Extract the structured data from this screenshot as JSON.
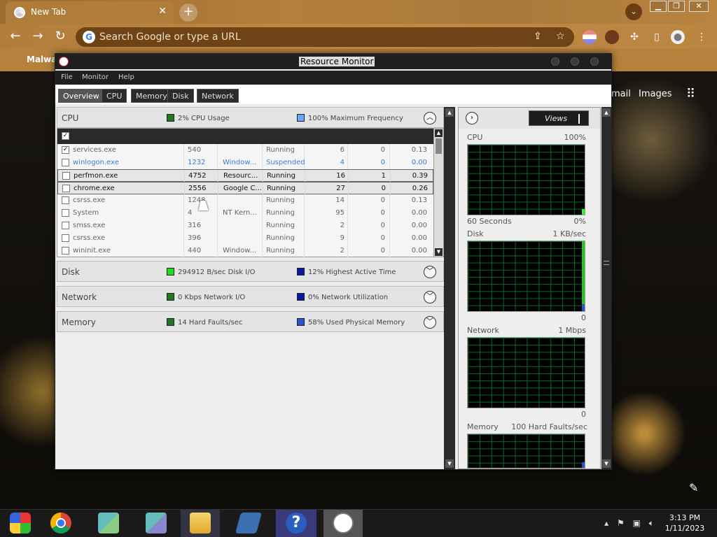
{
  "browser": {
    "tab_title": "New Tab",
    "tab_close": "✕",
    "new_tab": "+",
    "omnibox_placeholder": "Search Google or type a URL",
    "bookmark": "Malwar",
    "ntp_gmail": "mail",
    "ntp_images": "Images"
  },
  "rm": {
    "title": "Resource Monitor",
    "menu": [
      "File",
      "Monitor",
      "Help"
    ],
    "tabs": [
      "Overview",
      "CPU",
      "Memory",
      "Disk",
      "Network"
    ],
    "active_tab": "Overview",
    "cpu": {
      "name": "CPU",
      "stat1": "2% CPU Usage",
      "stat1_color": "#1e7a1e",
      "stat2": "100% Maximum Frequency",
      "stat2_color": "#66aaff",
      "processes": [
        {
          "name": "services.exe",
          "pid": "540",
          "desc": "",
          "status": "Running",
          "threads": "6",
          "cpu": "0",
          "avg": "0.13",
          "checked": true,
          "style": ""
        },
        {
          "name": "winlogon.exe",
          "pid": "1232",
          "desc": "Window...",
          "status": "Suspended",
          "threads": "4",
          "cpu": "0",
          "avg": "0.00",
          "checked": false,
          "style": "blue"
        },
        {
          "name": "perfmon.exe",
          "pid": "4752",
          "desc": "Resourc...",
          "status": "Running",
          "threads": "16",
          "cpu": "1",
          "avg": "0.39",
          "checked": false,
          "style": "hl"
        },
        {
          "name": "chrome.exe",
          "pid": "2556",
          "desc": "Google C...",
          "status": "Running",
          "threads": "27",
          "cpu": "0",
          "avg": "0.26",
          "checked": false,
          "style": "hl"
        },
        {
          "name": "csrss.exe",
          "pid": "1248",
          "desc": "",
          "status": "Running",
          "threads": "14",
          "cpu": "0",
          "avg": "0.13",
          "checked": false,
          "style": ""
        },
        {
          "name": "System",
          "pid": "4",
          "desc": "NT Kern...",
          "status": "Running",
          "threads": "95",
          "cpu": "0",
          "avg": "0.00",
          "checked": false,
          "style": ""
        },
        {
          "name": "smss.exe",
          "pid": "316",
          "desc": "",
          "status": "Running",
          "threads": "2",
          "cpu": "0",
          "avg": "0.00",
          "checked": false,
          "style": ""
        },
        {
          "name": "csrss.exe",
          "pid": "396",
          "desc": "",
          "status": "Running",
          "threads": "9",
          "cpu": "0",
          "avg": "0.00",
          "checked": false,
          "style": ""
        },
        {
          "name": "wininit.exe",
          "pid": "440",
          "desc": "Window...",
          "status": "Running",
          "threads": "2",
          "cpu": "0",
          "avg": "0.00",
          "checked": false,
          "style": ""
        }
      ]
    },
    "disk": {
      "name": "Disk",
      "stat1": "294912 B/sec Disk I/O",
      "stat1_color": "#22dd22",
      "stat2": "12% Highest Active Time",
      "stat2_color": "#0a1aa0"
    },
    "network": {
      "name": "Network",
      "stat1": "0 Kbps Network I/O",
      "stat1_color": "#1e7a1e",
      "stat2": "0% Network Utilization",
      "stat2_color": "#0a1aa0"
    },
    "memory": {
      "name": "Memory",
      "stat1": "14 Hard Faults/sec",
      "stat1_color": "#1e7a1e",
      "stat2": "58% Used Physical Memory",
      "stat2_color": "#2a55cc"
    },
    "views": "Views",
    "graphs": {
      "cpu_label": "CPU",
      "cpu_max": "100%",
      "cpu_time": "60 Seconds",
      "cpu_min": "0%",
      "disk_label": "Disk",
      "disk_max": "1 KB/sec",
      "disk_min": "0",
      "net_label": "Network",
      "net_max": "1 Mbps",
      "net_min": "0",
      "mem_label": "Memory",
      "mem_max": "100 Hard Faults/sec"
    }
  },
  "taskbar": {
    "time": "3:13 PM",
    "date": "1/11/2023"
  }
}
